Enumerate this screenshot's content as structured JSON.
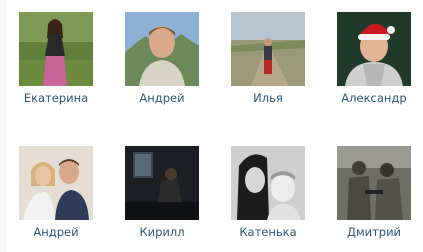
{
  "friends": [
    {
      "name": "Екатерина",
      "photo": "woman-dress-outdoor-photo"
    },
    {
      "name": "Андрей",
      "photo": "man-portrait-mountains-photo"
    },
    {
      "name": "Илья",
      "photo": "person-walking-path-photo"
    },
    {
      "name": "Александр",
      "photo": "man-santa-hat-photo"
    },
    {
      "name": "Андрей",
      "photo": "couple-selfie-photo"
    },
    {
      "name": "Кирилл",
      "photo": "dark-interior-photo"
    },
    {
      "name": "Катенька",
      "photo": "woman-child-bw-photo"
    },
    {
      "name": "Дмитрий",
      "photo": "soldiers-group-photo"
    }
  ]
}
